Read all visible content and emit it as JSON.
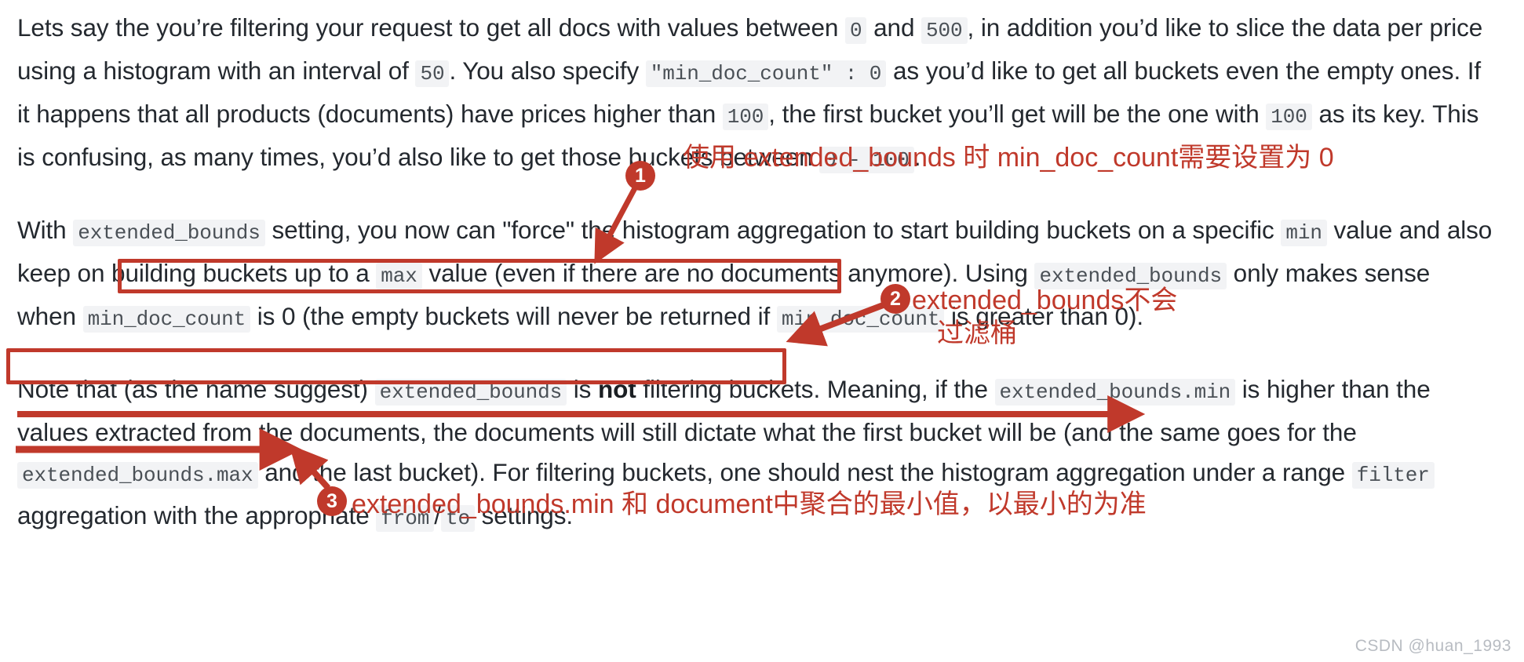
{
  "document": {
    "paragraphs": [
      {
        "id": "p1",
        "runs": [
          {
            "t": "Lets say the you’re filtering your request to get all docs with values between ",
            "k": "text"
          },
          {
            "t": "0",
            "k": "code"
          },
          {
            "t": " and ",
            "k": "text"
          },
          {
            "t": "500",
            "k": "code"
          },
          {
            "t": ", in addition you’d like to slice the data per price using a histogram with an interval of ",
            "k": "text"
          },
          {
            "t": "50",
            "k": "code"
          },
          {
            "t": ". You also specify ",
            "k": "text"
          },
          {
            "t": "\"min_doc_count\" : 0",
            "k": "code"
          },
          {
            "t": " as you’d like to get all buckets even the empty ones. If it happens that all products (documents) have prices higher than ",
            "k": "text"
          },
          {
            "t": "100",
            "k": "code"
          },
          {
            "t": ", the first bucket you’ll get will be the one with ",
            "k": "text"
          },
          {
            "t": "100",
            "k": "code"
          },
          {
            "t": " as its key. This is confusing, as many times, you’d also like to get those buckets between ",
            "k": "text"
          },
          {
            "t": "0 - 100",
            "k": "code"
          },
          {
            "t": ".",
            "k": "text"
          }
        ]
      },
      {
        "id": "p2",
        "runs": [
          {
            "t": "With ",
            "k": "text"
          },
          {
            "t": "extended_bounds",
            "k": "code"
          },
          {
            "t": " setting, you now can \"force\" the histogram aggregation to start building buckets on a specific ",
            "k": "text"
          },
          {
            "t": "min",
            "k": "code"
          },
          {
            "t": " value and also keep on building buckets up to a ",
            "k": "text"
          },
          {
            "t": "max",
            "k": "code"
          },
          {
            "t": " value (even if there are no documents anymore). Using ",
            "k": "text"
          },
          {
            "t": "extended_bounds",
            "k": "code"
          },
          {
            "t": " only makes sense when ",
            "k": "text"
          },
          {
            "t": "min_doc_count",
            "k": "code"
          },
          {
            "t": " is 0 (the empty buckets will never be returned if ",
            "k": "text"
          },
          {
            "t": "min_doc_count",
            "k": "code"
          },
          {
            "t": " is greater than 0).",
            "k": "text"
          }
        ]
      },
      {
        "id": "p3",
        "runs": [
          {
            "t": "Note that (as the name suggest) ",
            "k": "text"
          },
          {
            "t": "extended_bounds",
            "k": "code"
          },
          {
            "t": " is ",
            "k": "text"
          },
          {
            "t": "not",
            "k": "bold"
          },
          {
            "t": " filtering buckets. Meaning, if the ",
            "k": "text"
          },
          {
            "t": "extended_bounds.min",
            "k": "code"
          },
          {
            "t": " is higher than the values extracted from the documents, the documents will still dictate what the first bucket will be (and the same goes for the ",
            "k": "text"
          },
          {
            "t": "extended_bounds.max",
            "k": "code"
          },
          {
            "t": " and the last bucket). For filtering buckets, one should nest the histogram aggregation under a range ",
            "k": "text"
          },
          {
            "t": "filter",
            "k": "code"
          },
          {
            "t": " aggregation with the appropriate ",
            "k": "text"
          },
          {
            "t": "from",
            "k": "code"
          },
          {
            "t": "/",
            "k": "text"
          },
          {
            "t": "to",
            "k": "code"
          },
          {
            "t": " settings.",
            "k": "text"
          }
        ]
      }
    ]
  },
  "annotations": {
    "accent_color": "#c0392b",
    "items": [
      {
        "number": "1",
        "text_lines": [
          "使用 extended_bounds 时 min_doc_count需要设置为 0"
        ]
      },
      {
        "number": "2",
        "text_lines": [
          "extended_bounds不会",
          "过滤桶"
        ]
      },
      {
        "number": "3",
        "text_lines": [
          "extended_bounds.min 和 document中聚合的最小值，以最小的为准"
        ]
      }
    ]
  },
  "watermark": {
    "text": "CSDN @huan_1993"
  }
}
